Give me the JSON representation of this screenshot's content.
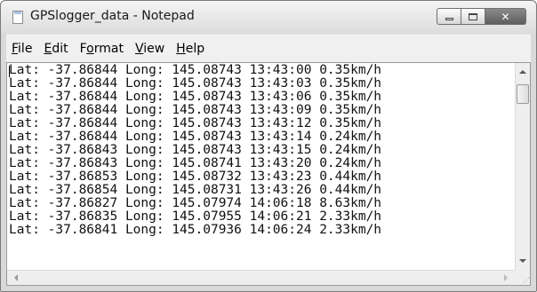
{
  "window": {
    "title": "GPSlogger_data - Notepad",
    "close_glyph": "✕"
  },
  "menu": [
    {
      "underline": "F",
      "rest": "ile"
    },
    {
      "underline": "E",
      "rest": "dit"
    },
    {
      "prefix": "F",
      "underline": "o",
      "rest": "rmat"
    },
    {
      "underline": "V",
      "rest": "iew"
    },
    {
      "underline": "H",
      "rest": "elp"
    }
  ],
  "lines": [
    "Lat: -37.86844 Long: 145.08743 13:43:00 0.35km/h",
    "Lat: -37.86844 Long: 145.08743 13:43:03 0.35km/h",
    "Lat: -37.86844 Long: 145.08743 13:43:06 0.35km/h",
    "Lat: -37.86844 Long: 145.08743 13:43:09 0.35km/h",
    "Lat: -37.86844 Long: 145.08743 13:43:12 0.35km/h",
    "Lat: -37.86844 Long: 145.08743 13:43:14 0.24km/h",
    "Lat: -37.86843 Long: 145.08743 13:43:15 0.24km/h",
    "Lat: -37.86843 Long: 145.08741 13:43:20 0.24km/h",
    "Lat: -37.86853 Long: 145.08732 13:43:23 0.44km/h",
    "Lat: -37.86854 Long: 145.08731 13:43:26 0.44km/h",
    "Lat: -37.86827 Long: 145.07974 14:06:18 8.63km/h",
    "Lat: -37.86835 Long: 145.07955 14:06:21 2.33km/h",
    "Lat: -37.86841 Long: 145.07936 14:06:24 2.33km/h"
  ],
  "icons": {
    "app": "notepad-icon",
    "minimize": "minimize-icon",
    "maximize": "maximize-icon",
    "close": "close-icon",
    "resize": "resize-grip-icon"
  }
}
